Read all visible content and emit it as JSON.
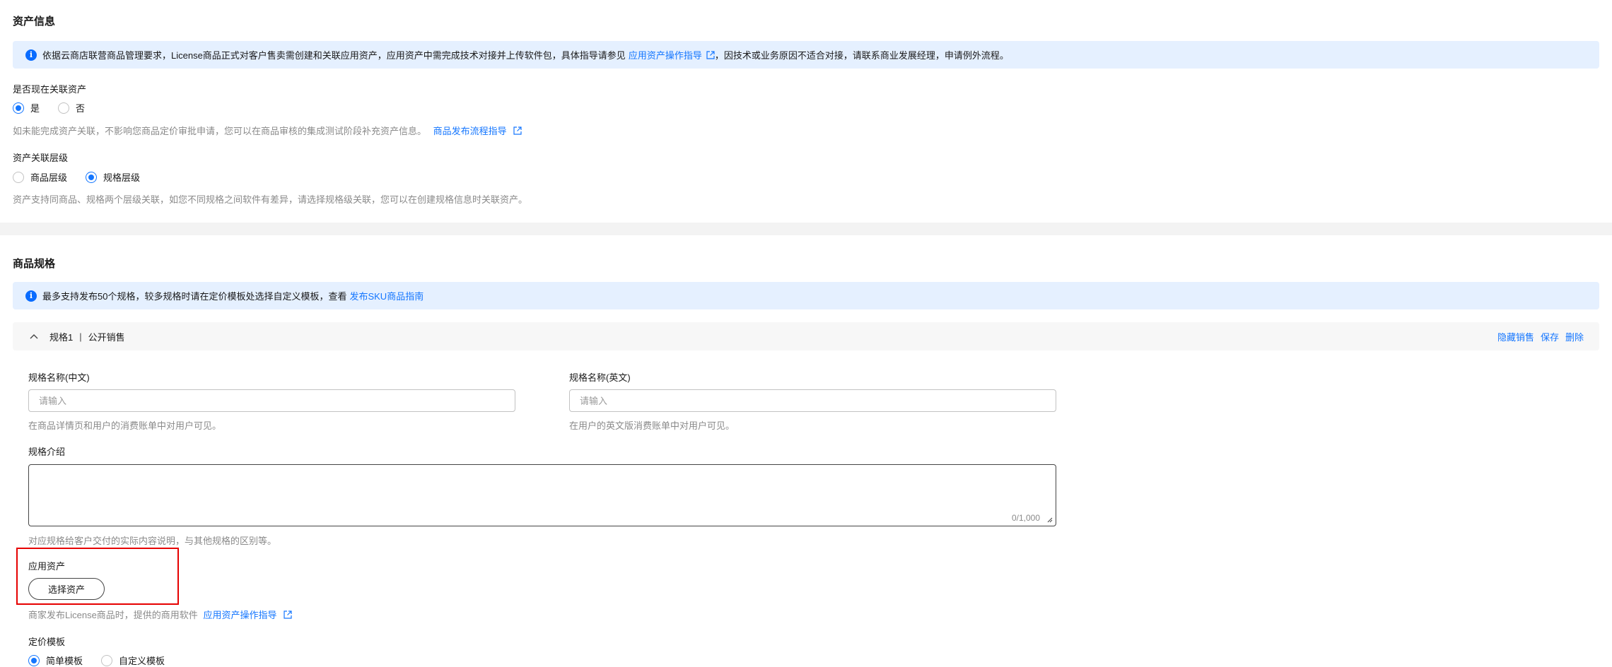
{
  "asset_info": {
    "title": "资产信息",
    "notice_text": "依据云商店联营商品管理要求，License商品正式对客户售卖需创建和关联应用资产，应用资产中需完成技术对接并上传软件包，具体指导请参见",
    "notice_link": "应用资产操作指导",
    "notice_suffix": "，因技术或业务原因不适合对接，请联系商业发展经理，申请例外流程。",
    "associate_label": "是否现在关联资产",
    "associate_options": [
      "是",
      "否"
    ],
    "associate_selected": "是",
    "associate_hint": "如未能完成资产关联，不影响您商品定价审批申请，您可以在商品审核的集成测试阶段补充资产信息。",
    "associate_hint_link": "商品发布流程指导",
    "level_label": "资产关联层级",
    "level_options": [
      "商品层级",
      "规格层级"
    ],
    "level_selected": "规格层级",
    "level_hint": "资产支持同商品、规格两个层级关联，如您不同规格之间软件有差异，请选择规格级关联，您可以在创建规格信息时关联资产。"
  },
  "spec": {
    "title": "商品规格",
    "notice_text": "最多支持发布50个规格，较多规格时请在定价模板处选择自定义模板，查看",
    "notice_link": "发布SKU商品指南",
    "header_name": "规格1",
    "header_sep": "|",
    "header_type": "公开销售",
    "actions": [
      "隐藏销售",
      "保存",
      "删除"
    ],
    "name_cn_label": "规格名称(中文)",
    "name_cn_placeholder": "请输入",
    "name_cn_hint": "在商品详情页和用户的消费账单中对用户可见。",
    "name_en_label": "规格名称(英文)",
    "name_en_placeholder": "请输入",
    "name_en_hint": "在用户的英文版消费账单中对用户可见。",
    "intro_label": "规格介绍",
    "intro_counter": "0/1,000",
    "intro_hint": "对应规格给客户交付的实际内容说明，与其他规格的区别等。",
    "app_asset_label": "应用资产",
    "select_asset_button": "选择资产",
    "app_asset_hint": "商家发布License商品时，提供的商用软件",
    "app_asset_link": "应用资产操作指导",
    "pricing_label": "定价模板",
    "pricing_options": [
      "简单模板",
      "自定义模板"
    ],
    "pricing_selected": "简单模板"
  },
  "colors": {
    "accent": "#1476ff",
    "notice_bg": "#e5f0ff",
    "highlight": "#e60000"
  }
}
